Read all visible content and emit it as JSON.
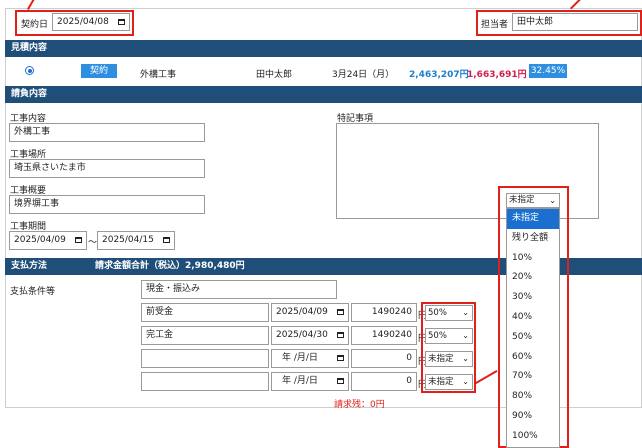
{
  "header": {
    "contract_date_label": "契約日",
    "contract_date_value": "2025/04/08",
    "person_label": "担当者",
    "person_value": "田中太郎"
  },
  "estimate": {
    "section_title": "見積内容",
    "status_badge": "契約",
    "work_name": "外構工事",
    "person": "田中太郎",
    "date": "3月24日（月）",
    "amount_blue": "2,463,207円",
    "amount_red": "1,663,691円",
    "percent": "32.45%"
  },
  "contract": {
    "section_title": "請負内容",
    "work_content_label": "工事内容",
    "work_content_value": "外構工事",
    "location_label": "工事場所",
    "location_value": "埼玉県さいたま市",
    "summary_label": "工事概要",
    "summary_value": "境界塀工事",
    "period_label": "工事期間",
    "period_start": "2025/04/09",
    "period_tilde": "〜",
    "period_end": "2025/04/15",
    "special_label": "特記事項"
  },
  "payment": {
    "section_title": "支払方法",
    "total_label": "請求金額合計（税込）2,980,480円",
    "conditions_label": "支払条件等",
    "method_value": "現金・振込み",
    "rows": [
      {
        "name": "前受金",
        "date": "2025/04/09",
        "amount": "1490240",
        "unit": "円",
        "select": "50%"
      },
      {
        "name": "完工金",
        "date": "2025/04/30",
        "amount": "1490240",
        "unit": "円",
        "select": "50%"
      },
      {
        "name": "",
        "date": "年 /月/日",
        "amount": "0",
        "unit": "円",
        "select": "未指定"
      },
      {
        "name": "",
        "date": "年 /月/日",
        "amount": "0",
        "unit": "円",
        "select": "未指定"
      }
    ],
    "remaining": "請求残：0円"
  },
  "dropdown": {
    "current": "未指定",
    "options": [
      "未指定",
      "残り全額",
      "10%",
      "20%",
      "30%",
      "40%",
      "50%",
      "60%",
      "70%",
      "80%",
      "90%",
      "100%"
    ]
  }
}
